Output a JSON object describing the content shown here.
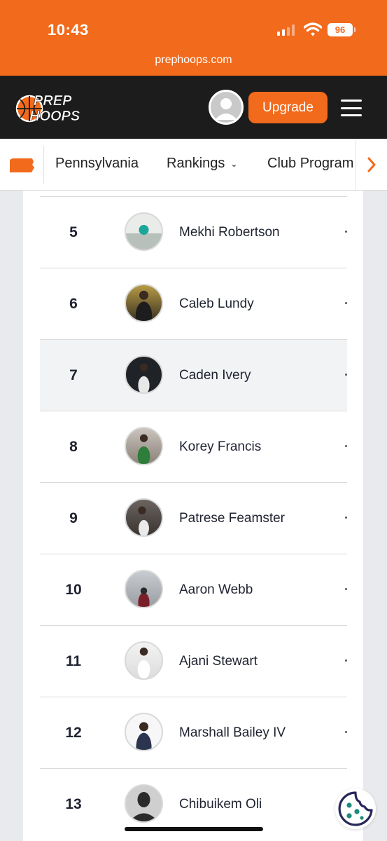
{
  "status_bar": {
    "time": "10:43",
    "battery": "96"
  },
  "browser": {
    "url": "prephoops.com"
  },
  "header": {
    "logo_line1": "PREP",
    "logo_line2": "HOOPS",
    "upgrade_label": "Upgrade"
  },
  "subnav": {
    "state": "Pennsylvania",
    "items": [
      {
        "label": "Rankings",
        "dropdown": true
      },
      {
        "label": "Club Program"
      }
    ]
  },
  "rankings": [
    {
      "rank": "5",
      "name": "Mekhi Robertson"
    },
    {
      "rank": "6",
      "name": "Caleb Lundy"
    },
    {
      "rank": "7",
      "name": "Caden Ivery",
      "highlighted": true
    },
    {
      "rank": "8",
      "name": "Korey Francis"
    },
    {
      "rank": "9",
      "name": "Patrese Feamster"
    },
    {
      "rank": "10",
      "name": "Aaron Webb"
    },
    {
      "rank": "11",
      "name": "Ajani Stewart"
    },
    {
      "rank": "12",
      "name": "Marshall Bailey IV"
    },
    {
      "rank": "13",
      "name": "Chibuikem Oli"
    }
  ],
  "colors": {
    "brand_orange": "#f26a1b",
    "header_dark": "#1c1c1c",
    "cookie_teal": "#1f8a7a",
    "cookie_navy": "#27275c"
  }
}
